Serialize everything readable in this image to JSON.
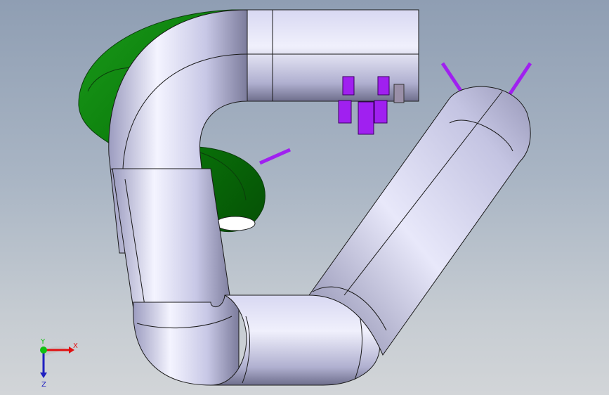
{
  "viewport": {
    "background_top": "#8f9eb3",
    "background_bottom": "#d2d5d8"
  },
  "model": {
    "pipe_color": "#c9c9ea",
    "pipe_shade": "#8a8aa6",
    "green_part_color": "#0a7a0a",
    "purple_part_color": "#a020f0",
    "edge_color": "#1a1a1a"
  },
  "triad": {
    "x_label": "X",
    "y_label": "Y",
    "z_label": "Z",
    "x_color": "#e01010",
    "y_color": "#10c010",
    "z_color": "#2020c0"
  }
}
